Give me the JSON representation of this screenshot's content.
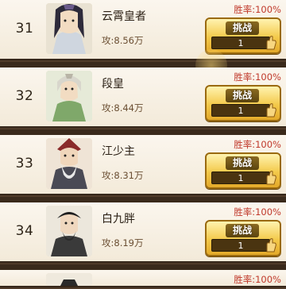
{
  "rows": [
    {
      "rank": "31",
      "name": "云霄皇者",
      "attack": "攻:8.56万",
      "winrate": "胜率:100%",
      "challenge_label": "挑战",
      "cost": "1"
    },
    {
      "rank": "32",
      "name": "段皇",
      "attack": "攻:8.44万",
      "winrate": "胜率:100%",
      "challenge_label": "挑战",
      "cost": "1"
    },
    {
      "rank": "33",
      "name": "江少主",
      "attack": "攻:8.31万",
      "winrate": "胜率:100%",
      "challenge_label": "挑战",
      "cost": "1"
    },
    {
      "rank": "34",
      "name": "白九胖",
      "attack": "攻:8.19万",
      "winrate": "胜率:100%",
      "challenge_label": "挑战",
      "cost": "1"
    },
    {
      "winrate": "胜率:100%"
    }
  ],
  "colors": {
    "accent_gold": "#f3c94a",
    "win_red": "#c0392b"
  }
}
